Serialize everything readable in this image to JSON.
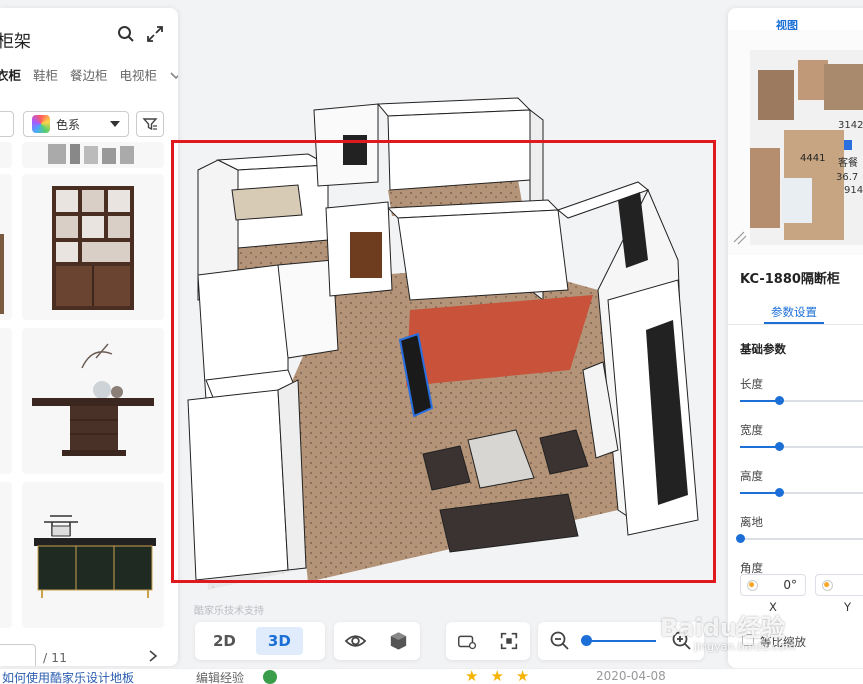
{
  "left_panel": {
    "title": "柜架",
    "categories": [
      "衣柜",
      "鞋柜",
      "餐边柜",
      "电视柜"
    ],
    "color_filter_label": "色系",
    "pager": {
      "current": "",
      "total": "/ 11"
    }
  },
  "viewport": {
    "support_text": "酷家乐技术支持",
    "view_modes": [
      "2D",
      "3D"
    ],
    "active_view_mode": "3D"
  },
  "right_panel": {
    "view_tab": "视图",
    "minimap_labels": [
      "3142",
      "4441",
      "客餐",
      "36.7",
      "914"
    ],
    "product_title": "KC-1880隔断柜",
    "tabs": [
      "参数设置"
    ],
    "section_title": "基础参数",
    "params": [
      {
        "label": "长度",
        "value_pct": 30
      },
      {
        "label": "宽度",
        "value_pct": 30
      },
      {
        "label": "高度",
        "value_pct": 30
      },
      {
        "label": "离地",
        "value_pct": 0
      }
    ],
    "angle_label": "角度",
    "angle_x_value": "0°",
    "axis_labels": [
      "X",
      "Y"
    ],
    "equal_scale_label": "等比缩放"
  },
  "bottom_strip": {
    "link_text": "如何使用酷家乐设计地板",
    "category_text": "编辑经验",
    "date_text": "2020-04-08"
  },
  "watermark": {
    "brand": "Baidu经验",
    "url": "jingyan.baidu.com"
  },
  "colors": {
    "accent": "#1b6fd6",
    "highlight_border": "#e0191e",
    "accent_wall": "#c8523a"
  }
}
